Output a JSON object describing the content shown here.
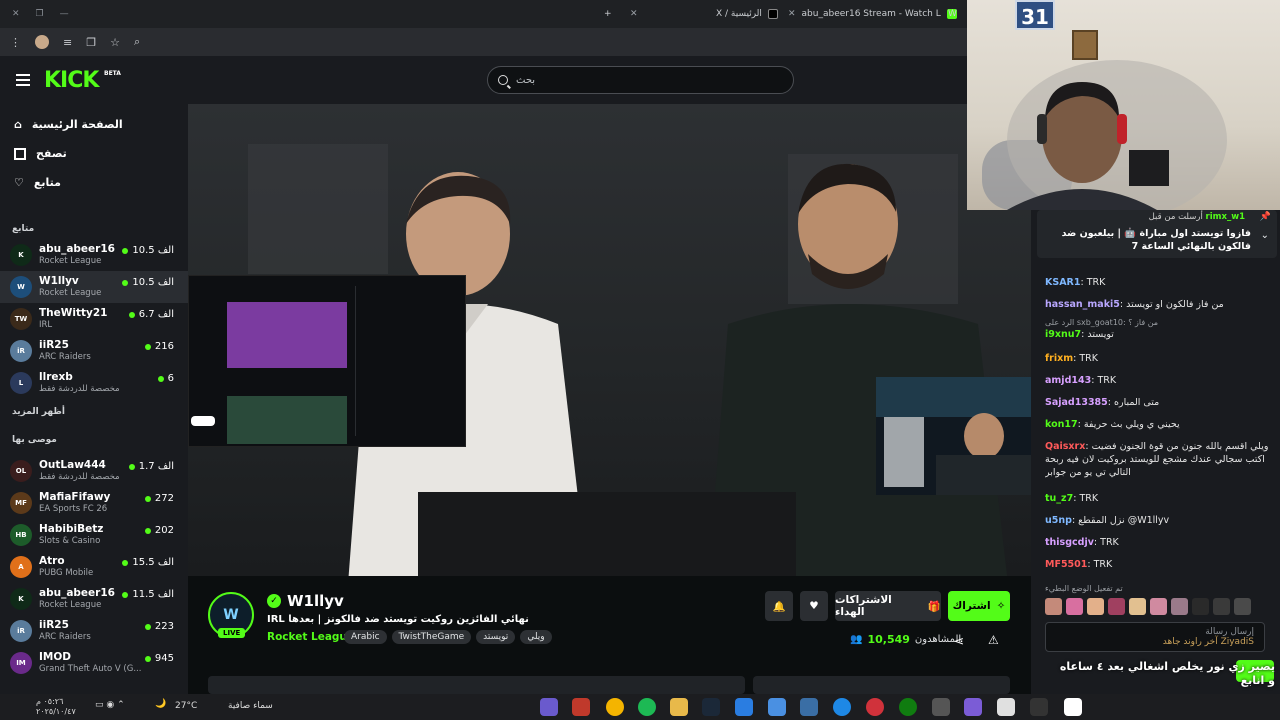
{
  "browser": {
    "tabs": [
      {
        "title": "X / الرئيسية",
        "color": "#000000"
      },
      {
        "title": "abu_abeer16 Stream - Watch L",
        "color": "#53fc18"
      },
      {
        "title": "W",
        "color": "#53fc18"
      }
    ],
    "new_tab": "+"
  },
  "header": {
    "logo": "KICK",
    "beta": "BETA",
    "search_placeholder": "بحث"
  },
  "sidebar": {
    "nav": [
      {
        "label": "الصفحة الرئيسية",
        "icon": "home-icon"
      },
      {
        "label": "تصفح",
        "icon": "browse-icon"
      },
      {
        "label": "متابع",
        "icon": "heart-icon"
      }
    ],
    "following_title": "متابع",
    "following": [
      {
        "name": "abu_abeer16",
        "category": "Rocket League",
        "viewers": "10.5 الف",
        "color": "#0f2a18",
        "initials": "K"
      },
      {
        "name": "W1llyv",
        "category": "Rocket League",
        "viewers": "10.5 الف",
        "color": "#1d4e7a",
        "initials": "W"
      },
      {
        "name": "TheWitty21",
        "category": "IRL",
        "viewers": "6.7 الف",
        "color": "#3b2a1a",
        "initials": "TW"
      },
      {
        "name": "iiR25",
        "category": "ARC Raiders",
        "viewers": "216",
        "color": "#5a7c9c",
        "initials": "iR"
      },
      {
        "name": "llrexb",
        "category": "مخصصة للدردشة فقط",
        "viewers": "6",
        "color": "#2b3a5c",
        "initials": "L"
      }
    ],
    "show_more": "أظهر المزيد",
    "recommended_title": "موصى بها",
    "recommended": [
      {
        "name": "OutLaw444",
        "category": "مخصصة للدردشة فقط",
        "viewers": "1.7 الف",
        "color": "#3a1d1d",
        "initials": "OL"
      },
      {
        "name": "MafiaFifawy",
        "category": "EA Sports FC 26",
        "viewers": "272",
        "color": "#5c3a1a",
        "initials": "MF"
      },
      {
        "name": "HabibiBetz",
        "category": "Slots & Casino",
        "viewers": "202",
        "color": "#1d5c2a",
        "initials": "HB"
      },
      {
        "name": "Atro",
        "category": "PUBG Mobile",
        "viewers": "15.5 الف",
        "color": "#e0701a",
        "initials": "A"
      },
      {
        "name": "abu_abeer16",
        "category": "Rocket League",
        "viewers": "11.5 الف",
        "color": "#0f2a18",
        "initials": "K"
      },
      {
        "name": "iiR25",
        "category": "ARC Raiders",
        "viewers": "223",
        "color": "#5a7c9c",
        "initials": "iR"
      },
      {
        "name": "IMOD",
        "category": "Grand Theft Auto V (G...",
        "viewers": "945",
        "color": "#6a2a8a",
        "initials": "IM"
      }
    ]
  },
  "channel": {
    "name": "W1llyv",
    "live": "LIVE",
    "title": "IRL⁩⁦ نهائي الفائزين روكيت تويستد ضد فالكونز | بعدها",
    "category": "Rocket League",
    "tags": [
      "Arabic",
      "TwistTheGame",
      "تويستد",
      "ويلي"
    ],
    "viewers_label": "المشاهدون",
    "viewers": "10,549",
    "subscribe_label": "اشتراك",
    "gift_label": "الاشتراكات الهداء"
  },
  "chat": {
    "pinned_user": "rimx_w1",
    "pinned_by": "أرسلت من قبل",
    "pinned_text": "فازوا تويستد اول مباراة 🤖 | بيلعبون ضد فالكون بالنهائي الساعة 7",
    "messages": [
      {
        "user": "KSAR1",
        "text": "TRK",
        "color": "#7fb8ff"
      },
      {
        "user": "hassan_maki5",
        "text": "من فاز فالكون او تويستد",
        "color": "#b9a7ff"
      },
      {
        "user": "i9xnu7",
        "text": "تويستد",
        "color": "#53fc18"
      },
      {
        "user": "frixm",
        "text": "TRK",
        "color": "#ffb020"
      },
      {
        "user": "amjd143",
        "text": "TRK",
        "color": "#d7a0ff"
      },
      {
        "user": "Sajad13385",
        "text": "متى المباره",
        "color": "#d7a0ff"
      },
      {
        "user": "kon17",
        "text": "يحيني ي ويلي بث حريفة",
        "color": "#53fc18"
      },
      {
        "user": "Qaisxrx",
        "text": "ويلي اقسم بالله جنون من قوة الجنون فضيت اكتب سجالي عندك مشجع للويستد بروكيت لان فيه ربحة التالي تي يو من جوابر",
        "color": "#ff5a5a"
      },
      {
        "user": "tu_z7",
        "text": "TRK",
        "color": "#53fc18"
      },
      {
        "user": "u5np",
        "text": "نزل المقطع @W1llyv",
        "color": "#7fb8ff"
      },
      {
        "user": "thisgcdjv",
        "text": "TRK",
        "color": "#d7a0ff"
      },
      {
        "user": "MF5501",
        "text": "TRK",
        "color": "#ff5a5a"
      }
    ],
    "reply_to": "الرد على sxb_goat10: من فاز ؟",
    "emotes_note": "تم تفعيل الوضع البطيء",
    "input_placeholder": "إرسال رسالة",
    "prediction": "آخر راوند جاهد ZiyadiS",
    "overlay": "يصير زي نور يخلص اشغالي بعد ٤ ساعاه و انابع"
  },
  "taskbar": {
    "weather": "27°C",
    "weather_text": "سماء صافية",
    "time": "٠٥:٢٦ م",
    "date": "٢٠٢٥/١٠/٤٧"
  }
}
